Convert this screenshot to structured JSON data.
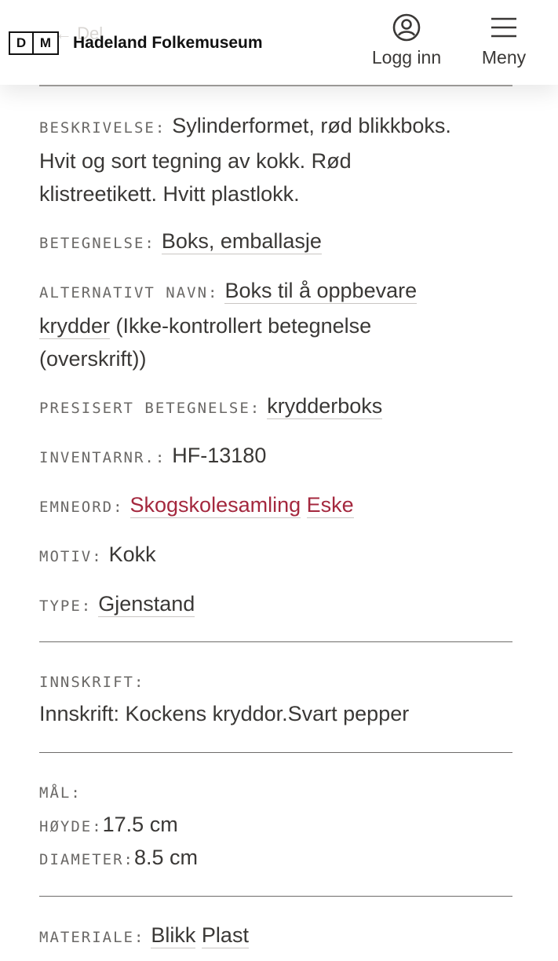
{
  "header": {
    "ghost_text": "← Del",
    "logo_letters": [
      "D",
      "M"
    ],
    "site_name": "Hadeland Folkemuseum",
    "login_label": "Logg inn",
    "menu_label": "Meny"
  },
  "fields": {
    "beskrivelse": {
      "label": "BESKRIVELSE:",
      "line1": "Sylinderformet, rød blikkboks.",
      "line2": "Hvit og sort tegning av kokk. Rød",
      "line3": "klistreetikett. Hvitt plastlokk."
    },
    "betegnelse": {
      "label": "BETEGNELSE:",
      "value": "Boks, emballasje"
    },
    "alternativt_navn": {
      "label": "ALTERNATIVT NAVN:",
      "link_part1": "Boks til å oppbevare",
      "link_part2": "krydder",
      "note1": " (Ikke-kontrollert betegnelse",
      "note2": "(overskrift))"
    },
    "presisert_betegnelse": {
      "label": "PRESISERT BETEGNELSE:",
      "value": "krydderboks"
    },
    "inventarnr": {
      "label": "INVENTARNR.:",
      "value": "HF-13180"
    },
    "emneord": {
      "label": "EMNEORD:",
      "values": [
        "Skogskolesamling",
        "Eske"
      ]
    },
    "motiv": {
      "label": "MOTIV:",
      "value": "Kokk"
    },
    "type": {
      "label": "TYPE:",
      "value": "Gjenstand"
    },
    "innskrift": {
      "label": "INNSKRIFT:",
      "value": "Innskrift: Kockens kryddor.Svart pepper"
    },
    "maal": {
      "label": "MÅL:",
      "hoyde_label": "HØYDE:",
      "hoyde_value": "17.5 cm",
      "diameter_label": "DIAMETER:",
      "diameter_value": "8.5 cm"
    },
    "materiale": {
      "label": "MATERIALE:",
      "values": [
        "Blikk",
        "Plast"
      ]
    }
  },
  "colors": {
    "text": "#3a3836",
    "label": "#6a6866",
    "link_accent": "#a4283e",
    "divider": "#6e6c6a"
  }
}
